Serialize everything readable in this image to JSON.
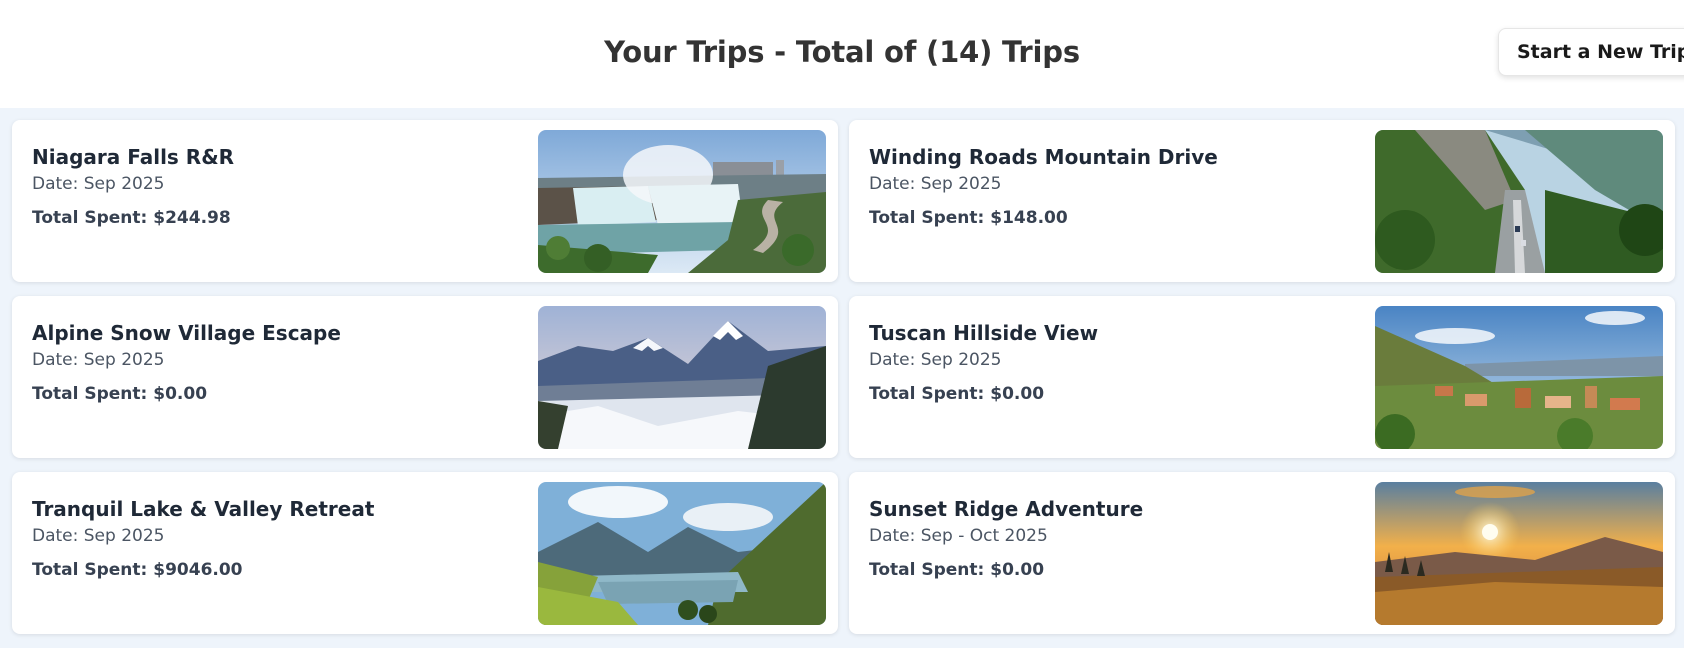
{
  "header": {
    "title": "Your Trips - Total of (14) Trips",
    "new_trip_label": "Start a New Trip"
  },
  "trips": [
    {
      "title": "Niagara Falls R&R",
      "date": "Date: Sep 2025",
      "total": "Total Spent: $244.98",
      "photo": "waterfall-photo"
    },
    {
      "title": "Winding Roads Mountain Drive",
      "date": "Date: Sep 2025",
      "total": "Total Spent: $148.00",
      "photo": "mountain-road-photo"
    },
    {
      "title": "Alpine Snow Village Escape",
      "date": "Date: Sep 2025",
      "total": "Total Spent: $0.00",
      "photo": "snowy-mountain-village-photo"
    },
    {
      "title": "Tuscan Hillside View",
      "date": "Date: Sep 2025",
      "total": "Total Spent: $0.00",
      "photo": "hillside-town-photo"
    },
    {
      "title": "Tranquil Lake & Valley Retreat",
      "date": "Date: Sep 2025",
      "total": "Total Spent: $9046.00",
      "photo": "lake-valley-photo"
    },
    {
      "title": "Sunset Ridge Adventure",
      "date": "Date: Sep - Oct 2025",
      "total": "Total Spent: $0.00",
      "photo": "sunset-ridge-photo"
    }
  ]
}
